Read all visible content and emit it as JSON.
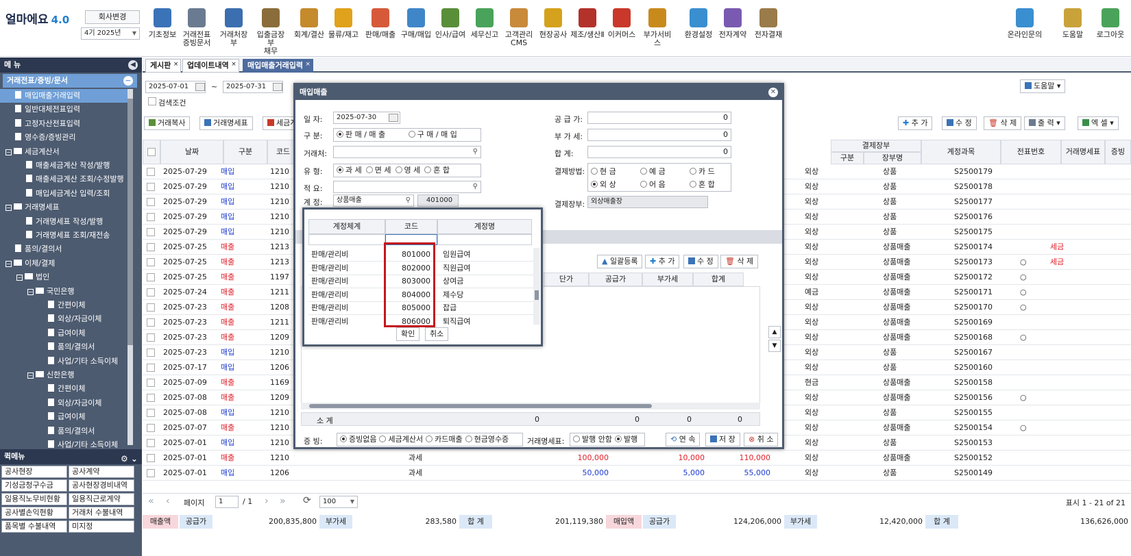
{
  "app": {
    "logo": "얼마에요",
    "version": "4.0",
    "company_button": "회사변경",
    "period": "4기 2025년"
  },
  "top_menu": [
    {
      "label": "기초정보",
      "icon": "info-icon",
      "color": "#3a73b8"
    },
    {
      "label": "거래전표\n증빙문서",
      "icon": "voucher-icon",
      "color": "#6a7b91"
    },
    {
      "label": "거래처장부",
      "icon": "ledger-icon",
      "color": "#3b6fb0"
    },
    {
      "label": "입출금장부\n채무",
      "icon": "money-bag-icon",
      "color": "#8a6d3b"
    },
    {
      "label": "회계/결산",
      "icon": "accounting-icon",
      "color": "#c48a2b"
    },
    {
      "label": "물류/재고",
      "icon": "logistics-icon",
      "color": "#e0a21c"
    },
    {
      "label": "판매/매출",
      "icon": "sales-icon",
      "color": "#d65a3a"
    },
    {
      "label": "구매/매입",
      "icon": "purchase-icon",
      "color": "#3f86c9"
    },
    {
      "label": "인사/급여",
      "icon": "hr-icon",
      "color": "#5a8f3a"
    },
    {
      "label": "세무신고",
      "icon": "tax-icon",
      "color": "#4aa35a"
    },
    {
      "label": "고객관리\nCMS",
      "icon": "customer-icon",
      "color": "#c98a3a"
    },
    {
      "label": "현장공사",
      "icon": "construction-icon",
      "color": "#d4a21c"
    },
    {
      "label": "제조/생산Ⅱ",
      "icon": "factory-icon",
      "color": "#b3322a"
    },
    {
      "label": "이커머스",
      "icon": "ecommerce-icon",
      "color": "#c9382a"
    },
    {
      "label": "부가서비스",
      "icon": "bank-icon",
      "color": "#c98a1c"
    },
    {
      "label": "환경설정",
      "icon": "gear-icon",
      "color": "#3a8fd0"
    },
    {
      "label": "전자계약",
      "icon": "contract-icon",
      "color": "#7a5ab0"
    },
    {
      "label": "전자결재",
      "icon": "approval-icon",
      "color": "#9a7b4a"
    }
  ],
  "right_menu": [
    {
      "label": "온라인문의",
      "icon": "support-icon",
      "color": "#3a8fd0"
    },
    {
      "label": "도움말",
      "icon": "help-icon",
      "color": "#c9a23a"
    },
    {
      "label": "로그아웃",
      "icon": "logout-icon",
      "color": "#4aa35a"
    }
  ],
  "sidebar": {
    "title": "메 뉴",
    "section": "거래전표/증빙/문서",
    "items": [
      {
        "label": "매입매출거래입력",
        "type": "doc",
        "indent": 0,
        "selected": true
      },
      {
        "label": "일반대체전표입력",
        "type": "doc",
        "indent": 0
      },
      {
        "label": "고정자산전표입력",
        "type": "doc",
        "indent": 0
      },
      {
        "label": "영수증/증빙관리",
        "type": "doc",
        "indent": 0
      },
      {
        "label": "세금계산서",
        "type": "folder",
        "indent": 0
      },
      {
        "label": "매출세금계산 작성/발행",
        "type": "doc",
        "indent": 1
      },
      {
        "label": "매출세금계산 조회/수정발행",
        "type": "doc",
        "indent": 1
      },
      {
        "label": "매입세금계산 입력/조회",
        "type": "doc",
        "indent": 1
      },
      {
        "label": "거래명세표",
        "type": "folder",
        "indent": 0
      },
      {
        "label": "거래명세표 작성/발행",
        "type": "doc",
        "indent": 1
      },
      {
        "label": "거래명세표 조회/재전송",
        "type": "doc",
        "indent": 1
      },
      {
        "label": "품의/결의서",
        "type": "doc",
        "indent": 0
      },
      {
        "label": "이체/결제",
        "type": "folder",
        "indent": 0
      },
      {
        "label": "법인",
        "type": "folder",
        "indent": 1
      },
      {
        "label": "국민은행",
        "type": "folder",
        "indent": 2
      },
      {
        "label": "간편이체",
        "type": "doc",
        "indent": 3
      },
      {
        "label": "외상/자금이체",
        "type": "doc",
        "indent": 3
      },
      {
        "label": "급여이체",
        "type": "doc",
        "indent": 3
      },
      {
        "label": "품의/결의서",
        "type": "doc",
        "indent": 3
      },
      {
        "label": "사업/기타 소득이체",
        "type": "doc",
        "indent": 3
      },
      {
        "label": "신한은행",
        "type": "folder",
        "indent": 2
      },
      {
        "label": "간편이체",
        "type": "doc",
        "indent": 3
      },
      {
        "label": "외상/자금이체",
        "type": "doc",
        "indent": 3
      },
      {
        "label": "급여이체",
        "type": "doc",
        "indent": 3
      },
      {
        "label": "품의/결의서",
        "type": "doc",
        "indent": 3
      },
      {
        "label": "사업/기타 소득이체",
        "type": "doc",
        "indent": 3
      }
    ]
  },
  "quick_menu": {
    "title": "퀵메뉴",
    "items": [
      "공사현장",
      "공사계약",
      "기성금청구수금",
      "공사현장경비내역",
      "일용직노무비현황",
      "일용직근로계약",
      "공사별손익현황",
      "거래처 수불내역",
      "품목별 수불내역",
      "미지정"
    ]
  },
  "tabs": [
    {
      "label": "게시판"
    },
    {
      "label": "업데이트내역"
    },
    {
      "label": "매입매출거래입력",
      "active": true
    }
  ],
  "filter": {
    "date_from": "2025-07-01",
    "tilde": "~",
    "date_to": "2025-07-31",
    "search_label": "검색조건",
    "help": "도움말"
  },
  "toolbar": {
    "copy": "거래복사",
    "statement": "거래명세표",
    "tax": "세금계산",
    "add": "추 가",
    "edit": "수 정",
    "delete": "삭 제",
    "print": "출 력",
    "excel": "엑 셀"
  },
  "grid": {
    "headers": {
      "date": "날짜",
      "type": "구분",
      "code": "코드",
      "settle": "결제장부",
      "settle_type": "구분",
      "settle_book": "장부명",
      "account": "계정과목",
      "voucher": "전표번호",
      "stmt": "거래명세표",
      "proof": "증빙"
    },
    "rows": [
      {
        "date": "2025-07-29",
        "type": "매입",
        "code": "1210",
        "stype": "외상",
        "account": "상품",
        "voucher": "S2500179"
      },
      {
        "date": "2025-07-29",
        "type": "매입",
        "code": "1210",
        "stype": "외상",
        "account": "상품",
        "voucher": "S2500178"
      },
      {
        "date": "2025-07-29",
        "type": "매입",
        "code": "1210",
        "stype": "외상",
        "account": "상품",
        "voucher": "S2500177"
      },
      {
        "date": "2025-07-29",
        "type": "매입",
        "code": "1210",
        "stype": "외상",
        "account": "상품",
        "voucher": "S2500176"
      },
      {
        "date": "2025-07-29",
        "type": "매입",
        "code": "1210",
        "stype": "외상",
        "account": "상품",
        "voucher": "S2500175"
      },
      {
        "date": "2025-07-25",
        "type": "매출",
        "code": "1213",
        "stype": "외상",
        "account": "상품매출",
        "voucher": "S2500174",
        "proof": "세금"
      },
      {
        "date": "2025-07-25",
        "type": "매출",
        "code": "1213",
        "stype": "외상",
        "account": "상품매출",
        "voucher": "S2500173",
        "stmt": "○",
        "proof": "세금"
      },
      {
        "date": "2025-07-25",
        "type": "매출",
        "code": "1197",
        "stype": "외상",
        "account": "상품매출",
        "voucher": "S2500172",
        "stmt": "○"
      },
      {
        "date": "2025-07-24",
        "type": "매출",
        "code": "1211",
        "stype": "예금",
        "account": "상품매출",
        "voucher": "S2500171",
        "stmt": "○"
      },
      {
        "date": "2025-07-23",
        "type": "매출",
        "code": "1208",
        "stype": "외상",
        "account": "상품매출",
        "voucher": "S2500170",
        "stmt": "○"
      },
      {
        "date": "2025-07-23",
        "type": "매출",
        "code": "1211",
        "stype": "외상",
        "account": "상품매출",
        "voucher": "S2500169"
      },
      {
        "date": "2025-07-23",
        "type": "매출",
        "code": "1209",
        "stype": "외상",
        "account": "상품매출",
        "voucher": "S2500168",
        "stmt": "○"
      },
      {
        "date": "2025-07-23",
        "type": "매입",
        "code": "1210",
        "stype": "외상",
        "account": "상품",
        "voucher": "S2500167"
      },
      {
        "date": "2025-07-17",
        "type": "매입",
        "code": "1206",
        "stype": "외상",
        "account": "상품",
        "voucher": "S2500160"
      },
      {
        "date": "2025-07-09",
        "type": "매출",
        "code": "1169",
        "stype": "현금",
        "account": "상품매출",
        "voucher": "S2500158"
      },
      {
        "date": "2025-07-08",
        "type": "매출",
        "code": "1209",
        "stype": "외상",
        "account": "상품매출",
        "voucher": "S2500156",
        "stmt": "○"
      },
      {
        "date": "2025-07-08",
        "type": "매입",
        "code": "1210",
        "stype": "외상",
        "account": "상품",
        "voucher": "S2500155"
      },
      {
        "date": "2025-07-07",
        "type": "매출",
        "code": "1210",
        "stype": "외상",
        "account": "상품매출",
        "voucher": "S2500154",
        "stmt": "○"
      },
      {
        "date": "2025-07-01",
        "type": "매입",
        "code": "1210",
        "stype": "외상",
        "account": "상품",
        "voucher": "S2500153"
      },
      {
        "date": "2025-07-01",
        "type": "매출",
        "code": "1210",
        "tax": "과세",
        "supply": "100,000",
        "vat": "10,000",
        "total": "110,000",
        "stype": "외상",
        "account": "상품매출",
        "voucher": "S2500152"
      },
      {
        "date": "2025-07-01",
        "type": "매입",
        "code": "1206",
        "tax": "과세",
        "supply": "50,000",
        "vat": "5,000",
        "total": "55,000",
        "stype": "외상",
        "account": "상품",
        "voucher": "S2500149"
      }
    ]
  },
  "pager": {
    "page_label": "페이지",
    "page": "1",
    "of": "/ 1",
    "size": "100",
    "display": "표시 1 - 21 of 21"
  },
  "summary": {
    "sales": "매출액",
    "sales_supply_l": "공급가",
    "sales_supply": "200,835,800",
    "sales_vat_l": "부가세",
    "sales_vat": "283,580",
    "sales_total_l": "합 계",
    "sales_total": "201,119,380",
    "buy": "매입액",
    "buy_supply_l": "공급가",
    "buy_supply": "124,206,000",
    "buy_vat_l": "부가세",
    "buy_vat": "12,420,000",
    "buy_total_l": "합 계",
    "buy_total": "136,626,000"
  },
  "dialog": {
    "title": "매입매출",
    "date_l": "일   자:",
    "date": "2025-07-30",
    "kind_l": "구   분:",
    "kind_sell": "판 매 / 매 출",
    "kind_buy": "구 매 / 매 입",
    "partner_l": "거래처:",
    "cat_l": "유   형:",
    "cat": [
      "과 세",
      "면 세",
      "영 세",
      "혼 합"
    ],
    "memo_l": "적   요:",
    "acct_l": "계   정:",
    "acct": "상품매출",
    "acct_code": "401000",
    "supply_l": "공 급 가:",
    "supply": "0",
    "vat_l": "부 가 세:",
    "vat": "0",
    "total_l": "합    계:",
    "total": "0",
    "pay_l": "결제방법:",
    "pay": [
      "현 금",
      "예 금",
      "카 드",
      "외 상",
      "어 음",
      "혼 합"
    ],
    "book_l": "결제장부:",
    "book": "외상매출장",
    "bulk": "일괄등록",
    "add": "추 가",
    "edit": "수 정",
    "delete": "삭 제",
    "cols": {
      "price": "단가",
      "supply": "공급가",
      "vat": "부가세",
      "total": "합계"
    },
    "subtotal_l": "소 계",
    "sub_v1": "0",
    "sub_v2": "0",
    "sub_v3": "0",
    "sub_v4": "0",
    "proof_l": "증 빙:",
    "proof": [
      "증빙없음",
      "세금계산서",
      "카드매출",
      "현금영수증"
    ],
    "stmt_l": "거래명세표:",
    "stmt": [
      "발행 안함",
      "발행"
    ],
    "cont": "연 속",
    "save": "저 장",
    "cancel": "취 소"
  },
  "popup": {
    "headers": {
      "system": "계정체계",
      "code": "코드",
      "name": "계정명"
    },
    "rows": [
      {
        "system": "판매/관리비",
        "code": "801000",
        "name": "임원급여"
      },
      {
        "system": "판매/관리비",
        "code": "802000",
        "name": "직원급여"
      },
      {
        "system": "판매/관리비",
        "code": "803000",
        "name": "상여금"
      },
      {
        "system": "판매/관리비",
        "code": "804000",
        "name": "제수당"
      },
      {
        "system": "판매/관리비",
        "code": "805000",
        "name": "잡급"
      },
      {
        "system": "판매/관리비",
        "code": "806000",
        "name": "퇴직급여"
      }
    ],
    "ok": "확인",
    "cancel": "취소"
  }
}
